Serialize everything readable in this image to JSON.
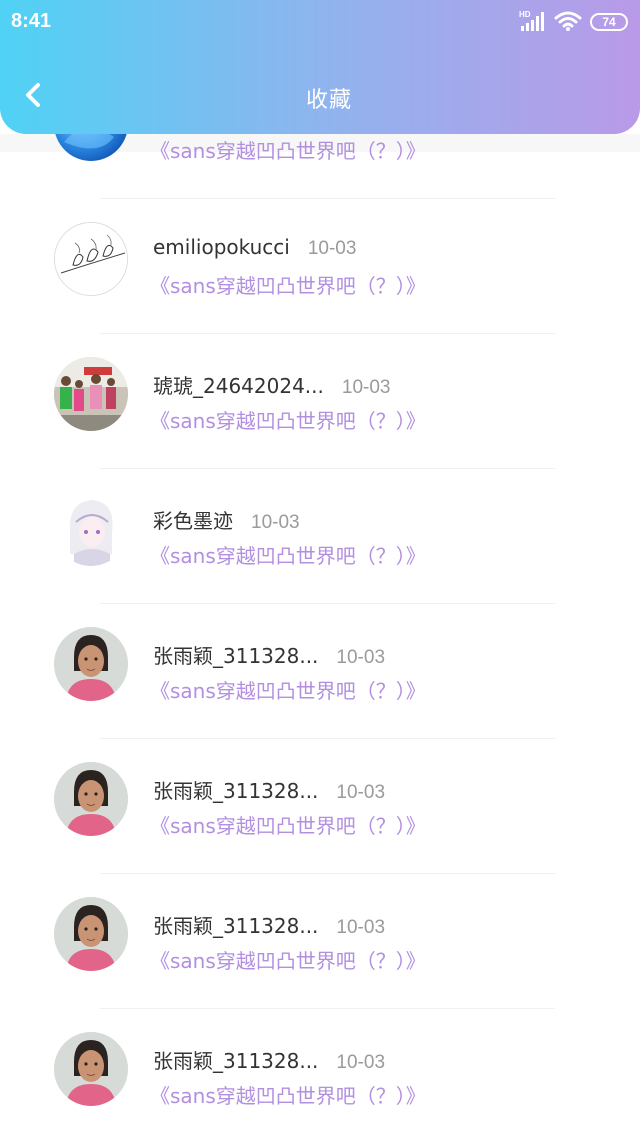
{
  "status_bar": {
    "time": "8:41",
    "battery": "74",
    "network_label": "HD"
  },
  "header": {
    "title": "收藏"
  },
  "list": [
    {
      "name": "",
      "date": "",
      "title": "《sans穿越凹凸世界吧（？）》",
      "avatar": "blue-avatar"
    },
    {
      "name": "emiliopokucci",
      "date": "10-03",
      "title": "《sans穿越凹凸世界吧（？）》",
      "avatar": "birds-sketch-avatar"
    },
    {
      "name": "琥琥_24642024...",
      "date": "10-03",
      "title": "《sans穿越凹凸世界吧（？）》",
      "avatar": "family-photo-avatar"
    },
    {
      "name": "彩色墨迹",
      "date": "10-03",
      "title": "《sans穿越凹凸世界吧（？）》",
      "avatar": "anime-avatar"
    },
    {
      "name": "张雨颖_311328...",
      "date": "10-03",
      "title": "《sans穿越凹凸世界吧（？）》",
      "avatar": "girl-photo-avatar"
    },
    {
      "name": "张雨颖_311328...",
      "date": "10-03",
      "title": "《sans穿越凹凸世界吧（？）》",
      "avatar": "girl-photo-avatar"
    },
    {
      "name": "张雨颖_311328...",
      "date": "10-03",
      "title": "《sans穿越凹凸世界吧（？）》",
      "avatar": "girl-photo-avatar"
    },
    {
      "name": "张雨颖_311328...",
      "date": "10-03",
      "title": "《sans穿越凹凸世界吧（？）》",
      "avatar": "girl-photo-avatar"
    }
  ],
  "colors": {
    "header_start": "#4fd2f5",
    "header_end": "#b99ae8",
    "link": "#b28fe0",
    "date": "#9a9a9a"
  }
}
